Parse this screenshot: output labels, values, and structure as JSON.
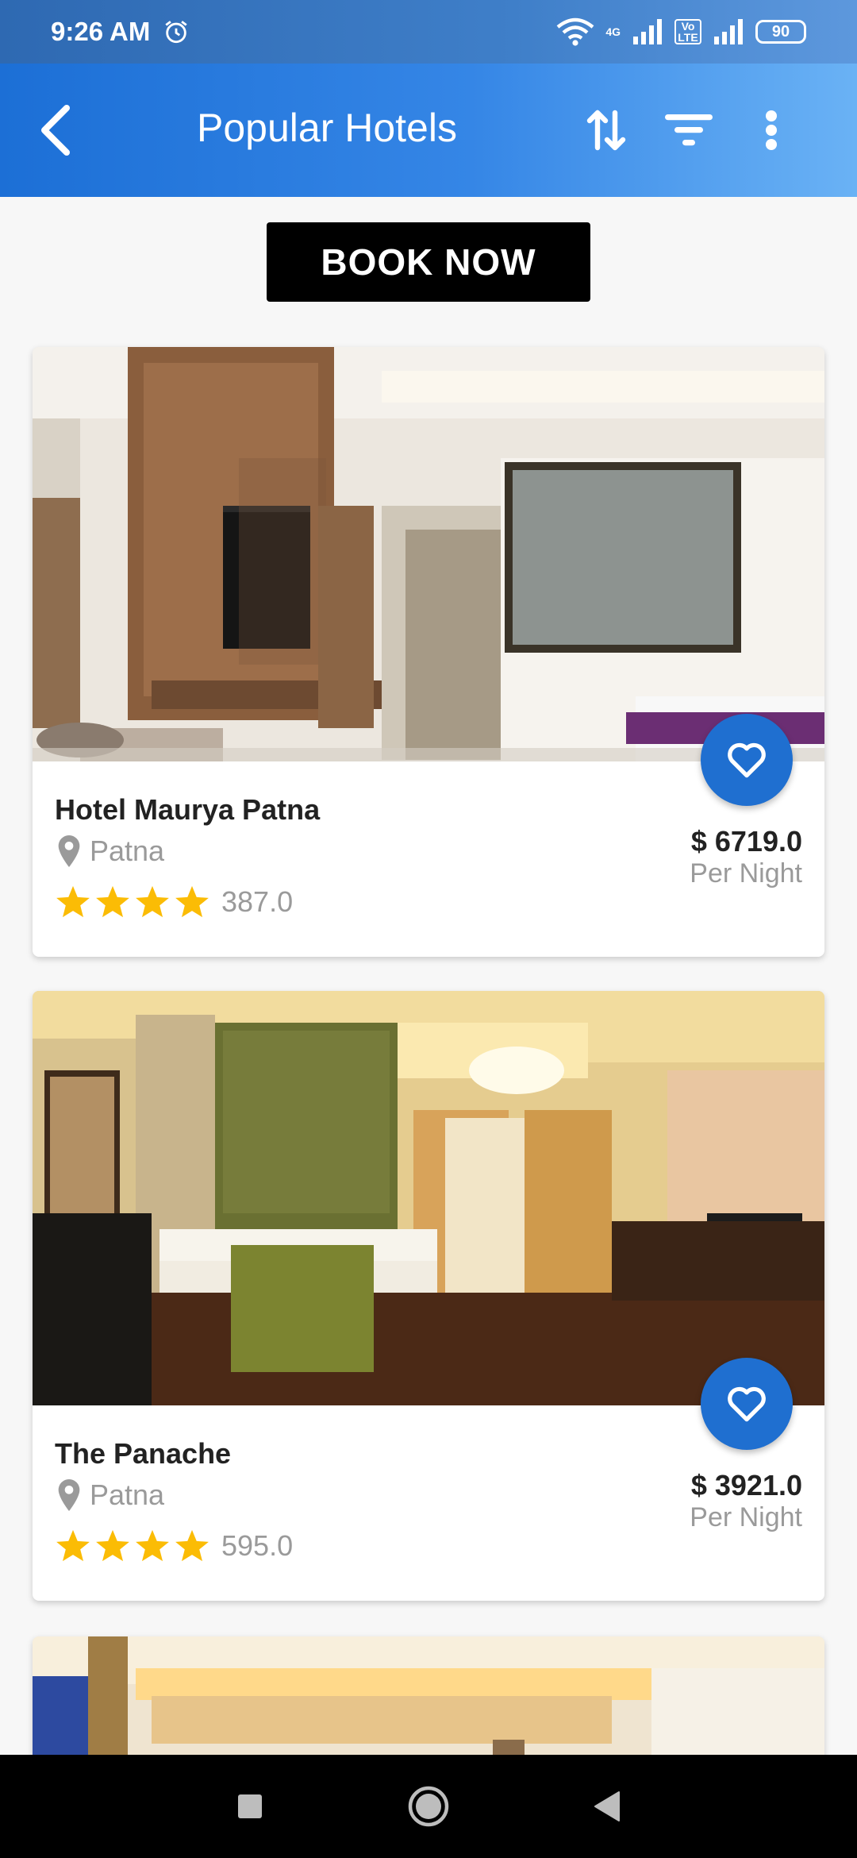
{
  "status_bar": {
    "time": "9:26 AM",
    "battery": "90",
    "network": "4G",
    "volte": "Vo LTE"
  },
  "app_bar": {
    "title": "Popular Hotels",
    "icons": [
      "back-arrow-icon",
      "sort-icon",
      "filter-icon",
      "more-vert-icon"
    ]
  },
  "book_now": {
    "label": "BOOK NOW"
  },
  "hotels": [
    {
      "name": "Hotel Maurya Patna",
      "location": "Patna",
      "stars": 4,
      "rating": "387.0",
      "price": "$ 6719.0",
      "per_night": "Per Night"
    },
    {
      "name": "The Panache",
      "location": "Patna",
      "stars": 4,
      "rating": "595.0",
      "price": "$ 3921.0",
      "per_night": "Per Night"
    }
  ],
  "colors": {
    "app_bar_start": "#1c6fd6",
    "app_bar_end": "#6ab2f5",
    "favorite_button": "#1f6fd0",
    "star": "#fbbc05",
    "muted_text": "#9a9a9a"
  }
}
